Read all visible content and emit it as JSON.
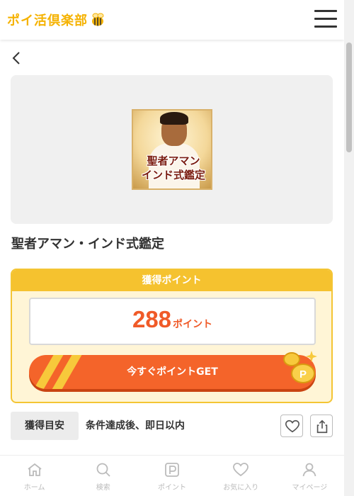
{
  "header": {
    "logo_text": "ポイ活倶楽部",
    "logo_icon": "bee-icon",
    "menu_icon": "hamburger-menu-icon"
  },
  "nav": {
    "back_icon": "chevron-left-icon"
  },
  "offer": {
    "thumbnail_line1": "聖者アマン",
    "thumbnail_line2": "インド式鑑定",
    "title": "聖者アマン・インド式鑑定"
  },
  "points": {
    "header_label": "獲得ポイント",
    "value": "288",
    "unit": "ポイント",
    "get_button_label": "今すぐポイントGET"
  },
  "estimate": {
    "label": "獲得目安",
    "value": "条件達成後、即日以内"
  },
  "actions": {
    "favorite_icon": "heart-icon",
    "share_icon": "share-icon"
  },
  "bottom_nav": {
    "items": [
      {
        "label": "ホーム",
        "icon": "home-icon"
      },
      {
        "label": "検索",
        "icon": "search-icon"
      },
      {
        "label": "ポイント",
        "icon": "point-icon"
      },
      {
        "label": "お気に入り",
        "icon": "heart-icon"
      },
      {
        "label": "マイページ",
        "icon": "user-icon"
      }
    ]
  },
  "colors": {
    "brand": "#f5b200",
    "accent": "#f05a28",
    "button": "#f4642a",
    "box_border": "#f4c534",
    "box_bg": "#fff5d6"
  }
}
